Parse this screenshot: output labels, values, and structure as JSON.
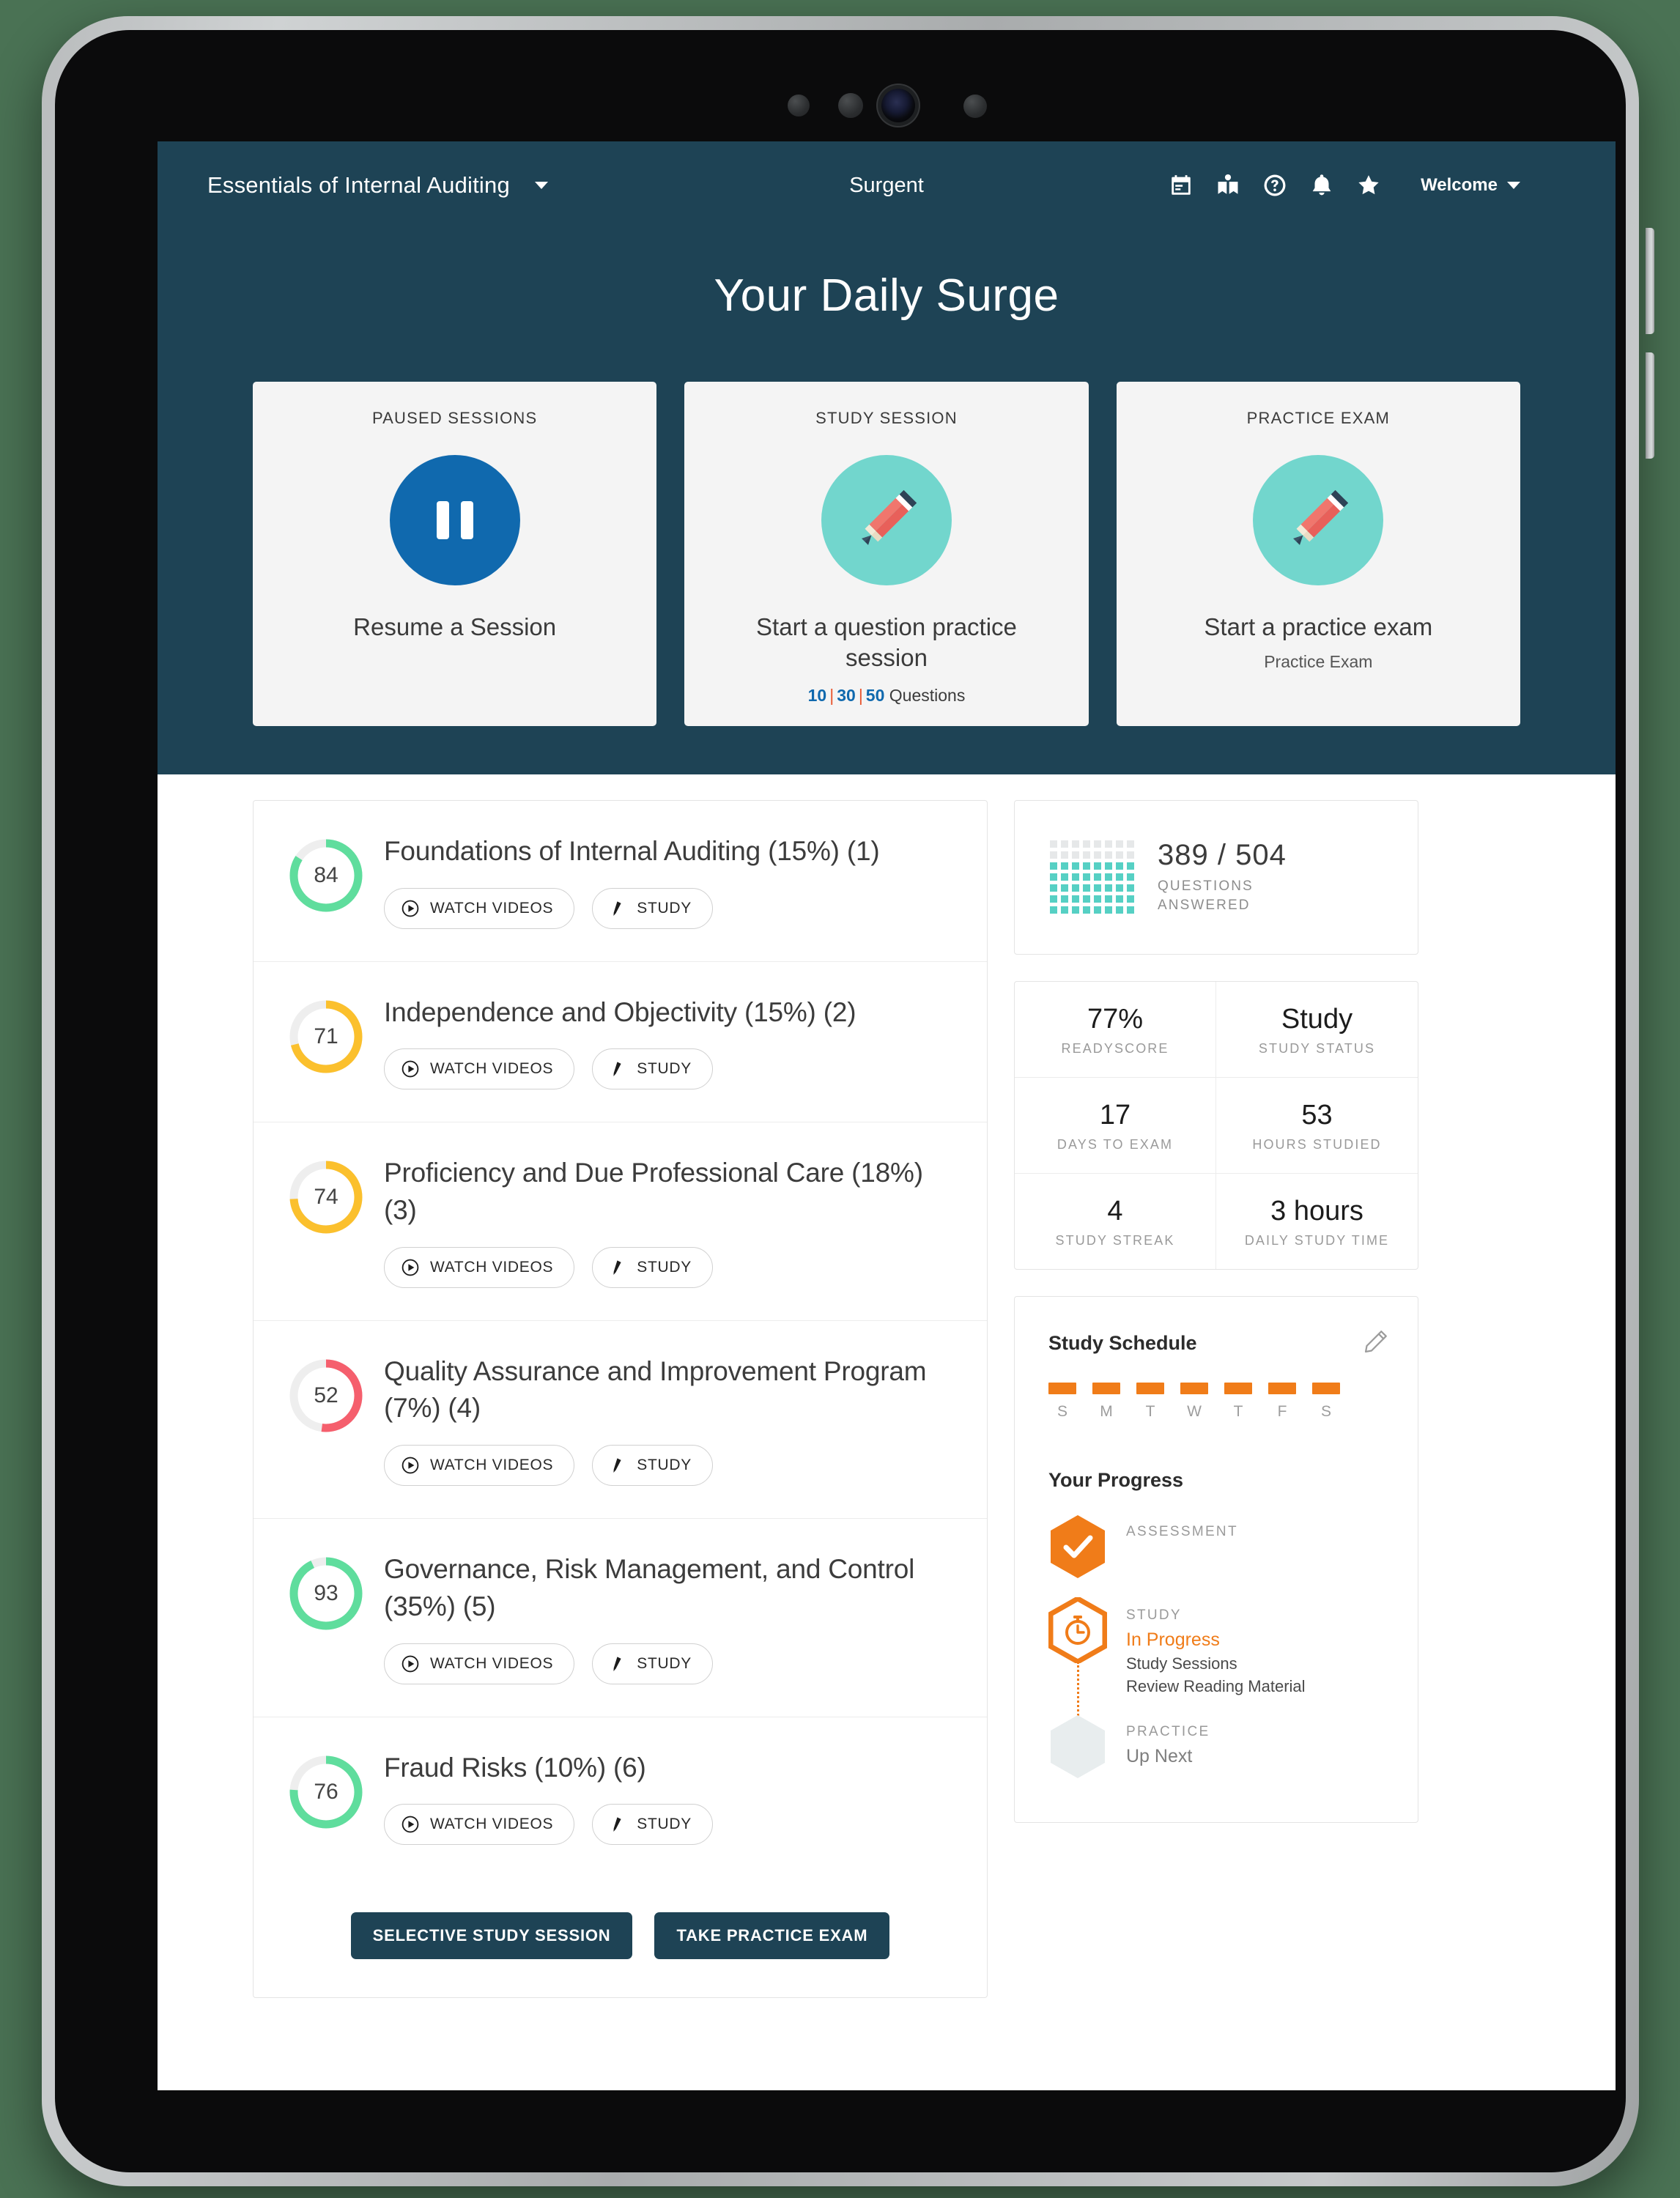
{
  "header": {
    "course_selector": "Essentials of Internal Auditing",
    "brand": "Surgent",
    "page_title": "Your Daily Surge",
    "welcome_label": "Welcome",
    "icons": [
      "calendar-icon",
      "book-icon",
      "help-circle-icon",
      "bell-icon",
      "star-icon"
    ]
  },
  "action_cards": [
    {
      "kicker": "PAUSED SESSIONS",
      "icon": "pause-icon",
      "label": "Resume a Session",
      "sub": "",
      "qcount": null,
      "circle_color": "#1069ae"
    },
    {
      "kicker": "STUDY SESSION",
      "icon": "pencil-icon",
      "label": "Start a question practice session",
      "sub": "",
      "qcount": {
        "opt1": "10",
        "opt2": "30",
        "opt3": "50",
        "suffix": "Questions"
      },
      "circle_color": "#72d6cd"
    },
    {
      "kicker": "PRACTICE EXAM",
      "icon": "pencil-icon",
      "label": "Start a practice exam",
      "sub": "Practice Exam",
      "qcount": null,
      "circle_color": "#72d6cd"
    }
  ],
  "topics": [
    {
      "score": 84,
      "color": "#5fdd9d",
      "title": "Foundations of Internal Auditing (15%) (1)",
      "watch_label": "WATCH VIDEOS",
      "study_label": "STUDY"
    },
    {
      "score": 71,
      "color": "#fbc02d",
      "title": "Independence and Objectivity (15%) (2)",
      "watch_label": "WATCH VIDEOS",
      "study_label": "STUDY"
    },
    {
      "score": 74,
      "color": "#fbc02d",
      "title": "Proficiency and Due Professional Care (18%) (3)",
      "watch_label": "WATCH VIDEOS",
      "study_label": "STUDY"
    },
    {
      "score": 52,
      "color": "#f55f6d",
      "title": "Quality Assurance and Improvement Program (7%) (4)",
      "watch_label": "WATCH VIDEOS",
      "study_label": "STUDY"
    },
    {
      "score": 93,
      "color": "#5fdd9d",
      "title": "Governance, Risk Management, and Control (35%) (5)",
      "watch_label": "WATCH VIDEOS",
      "study_label": "STUDY"
    },
    {
      "score": 76,
      "color": "#5fdd9d",
      "title": "Fraud Risks (10%) (6)",
      "watch_label": "WATCH VIDEOS",
      "study_label": "STUDY"
    }
  ],
  "panel_footer": {
    "selective_study_label": "SELECTIVE STUDY SESSION",
    "practice_exam_label": "TAKE PRACTICE EXAM"
  },
  "questions_answered": {
    "count": "389 / 504",
    "label_line1": "QUESTIONS",
    "label_line2": "ANSWERED",
    "grid_cols": 8,
    "grid_rows": 7,
    "filled_cells": 40,
    "fill_color": "#56d0c4",
    "empty_color": "#e6e8e9"
  },
  "stats": [
    {
      "value": "77%",
      "label": "READYSCORE"
    },
    {
      "value": "Study",
      "label": "STUDY STATUS"
    },
    {
      "value": "17",
      "label": "DAYS TO EXAM"
    },
    {
      "value": "53",
      "label": "HOURS STUDIED"
    },
    {
      "value": "4",
      "label": "STUDY STREAK"
    },
    {
      "value": "3 hours",
      "label": "DAILY STUDY TIME"
    }
  ],
  "schedule": {
    "title": "Study Schedule",
    "edit_icon": "pencil-edit-icon",
    "days": [
      {
        "letter": "S",
        "active": true
      },
      {
        "letter": "M",
        "active": true
      },
      {
        "letter": "T",
        "active": true
      },
      {
        "letter": "W",
        "active": true
      },
      {
        "letter": "T",
        "active": true
      },
      {
        "letter": "F",
        "active": true
      },
      {
        "letter": "S",
        "active": true
      }
    ],
    "accent_color": "#f07c19"
  },
  "progress": {
    "title": "Your Progress",
    "steps": [
      {
        "kicker": "ASSESSMENT",
        "status": "",
        "items": [],
        "state": "complete",
        "icon": "check-icon"
      },
      {
        "kicker": "STUDY",
        "status": "In Progress",
        "items": [
          "Study Sessions",
          "Review Reading Material"
        ],
        "state": "current",
        "icon": "stopwatch-icon"
      },
      {
        "kicker": "PRACTICE",
        "status": "Up Next",
        "items": [],
        "state": "upcoming",
        "icon": "blank-hex-icon"
      }
    ]
  },
  "colors": {
    "header_bg": "#1e4355",
    "accent_orange": "#f07c19",
    "accent_teal": "#72d6cd",
    "accent_blue": "#1069ae"
  }
}
